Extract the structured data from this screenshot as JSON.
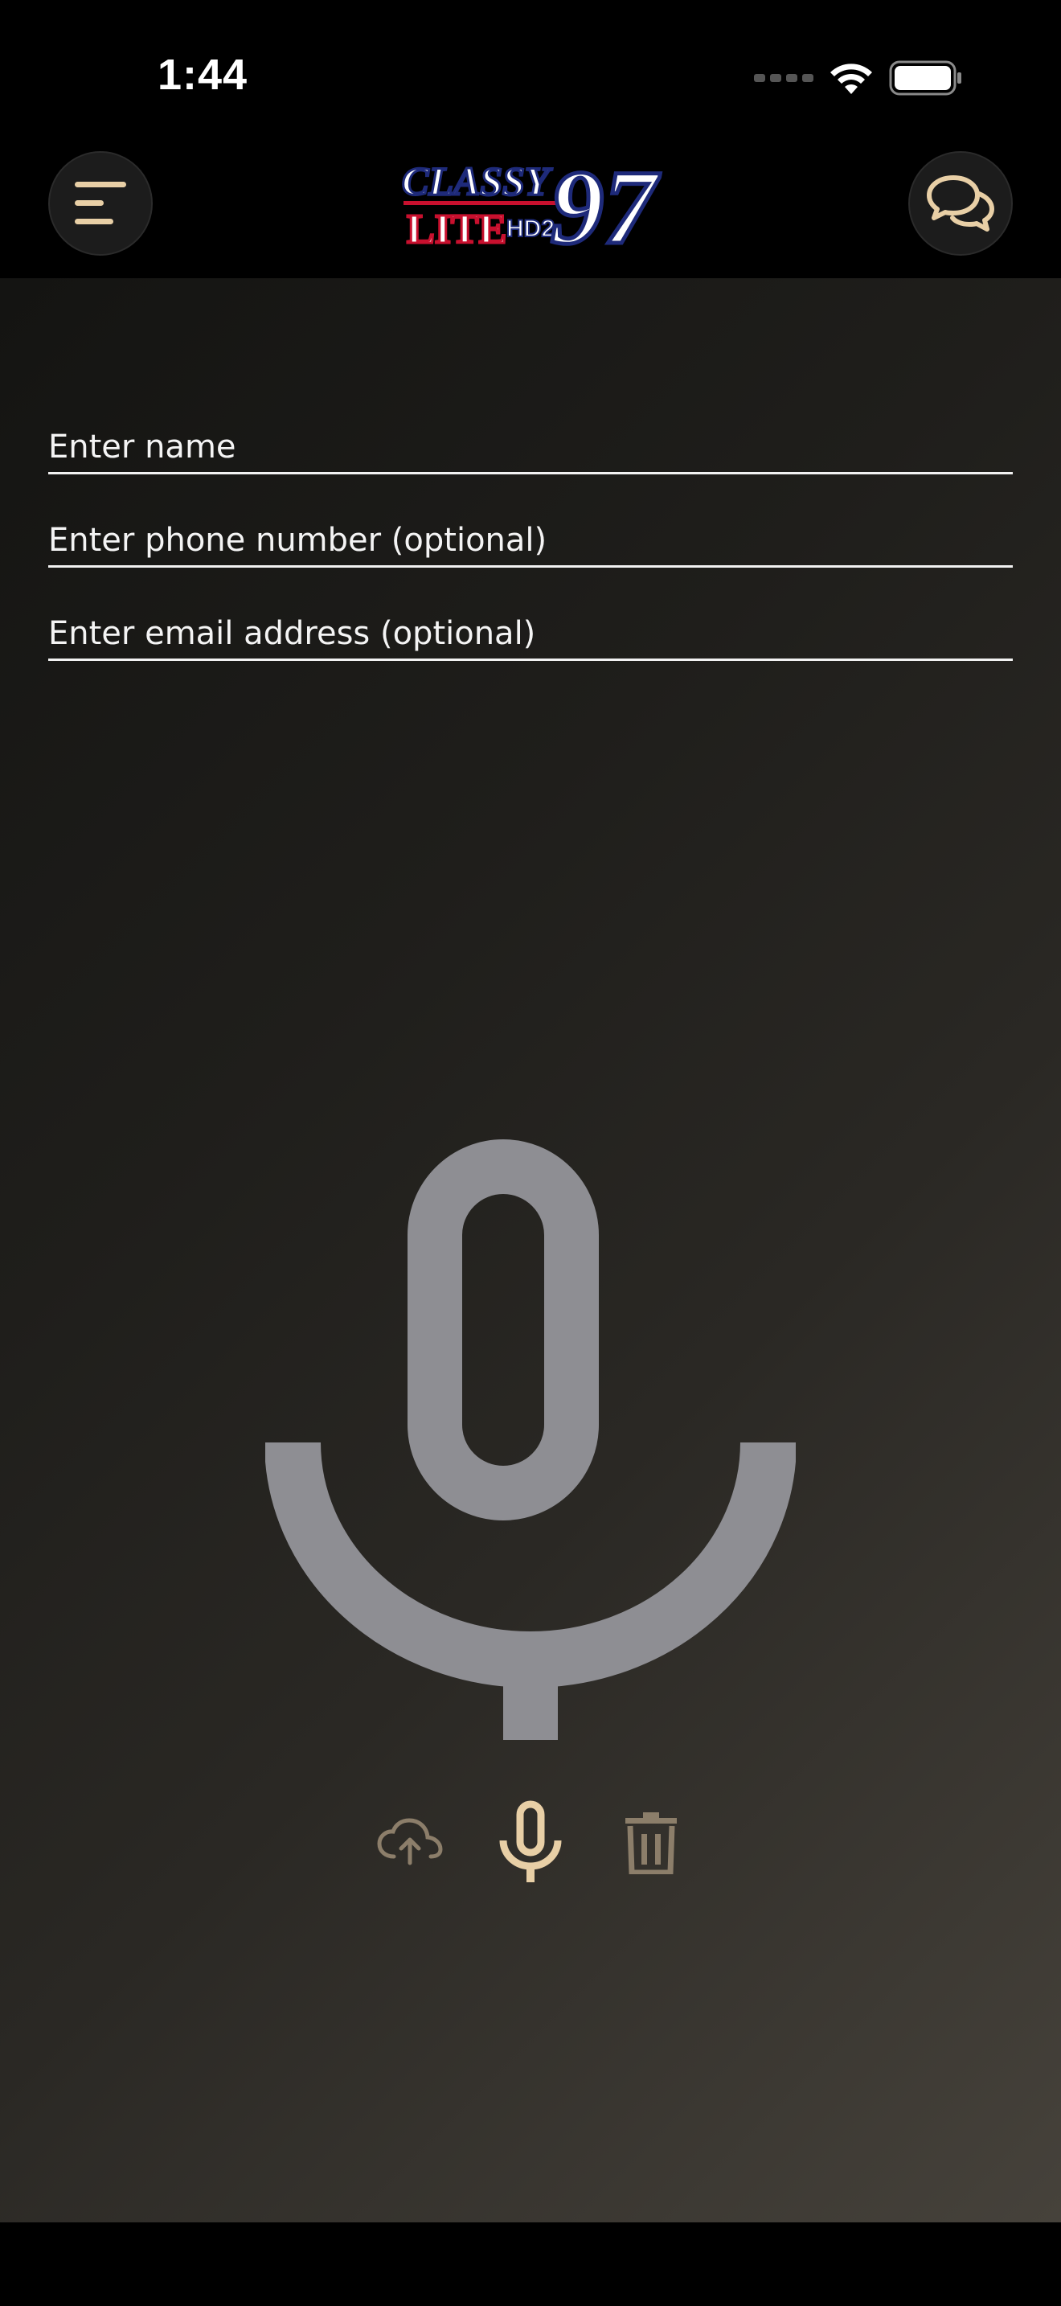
{
  "status_bar": {
    "time": "1:44",
    "icons": [
      "cellular-dots-icon",
      "wifi-icon",
      "battery-icon"
    ]
  },
  "nav": {
    "menu_icon": "menu-icon",
    "chat_icon": "chat-bubbles-icon",
    "logo": {
      "line1": "CLASSY",
      "line2": "LITE",
      "badge": "HD2",
      "number": "97"
    }
  },
  "form": {
    "name_placeholder": "Enter name",
    "phone_placeholder": "Enter phone number (optional)",
    "email_placeholder": "Enter email address (optional)"
  },
  "recorder": {
    "big_icon": "microphone-icon",
    "controls": [
      "cloud-upload-icon",
      "microphone-icon",
      "trash-icon"
    ]
  },
  "colors": {
    "accent": "#e8cfa6",
    "muted_accent": "#8c7e6a",
    "mic_gray": "#8e8e93",
    "logo_blue": "#1e2a7a",
    "logo_red": "#c8102e"
  }
}
